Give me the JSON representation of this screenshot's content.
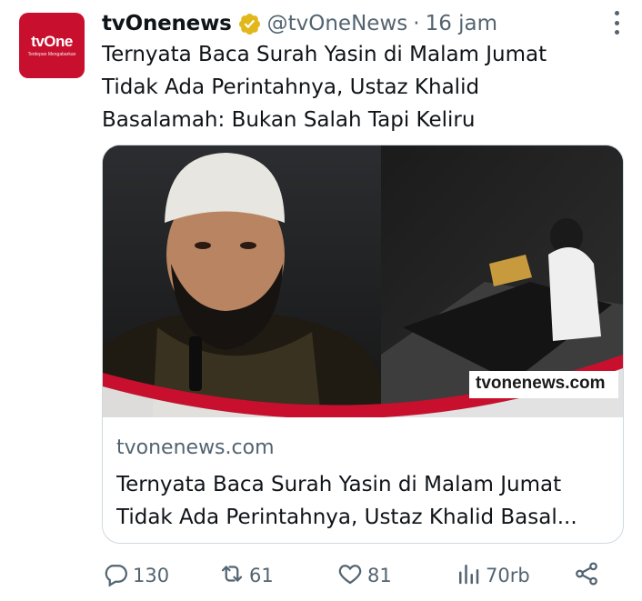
{
  "account": {
    "avatar_logo": "tvOne",
    "avatar_sub": "Terdepan Mengabarkan",
    "name": "tvOnenews",
    "handle": "@tvOneNews",
    "separator": "·",
    "time": "16 jam"
  },
  "tweet": {
    "text_lines": [
      "Ternyata Baca Surah Yasin di Malam Jumat",
      "Tidak Ada Perintahnya, Ustaz Khalid",
      "Basalamah: Bukan Salah Tapi Keliru"
    ]
  },
  "card": {
    "watermark": "tvonenews.com",
    "domain": "tvonenews.com",
    "title_lines": [
      "Ternyata Baca Surah Yasin di Malam Jumat",
      "Tidak Ada Perintahnya, Ustaz Khalid Basal..."
    ]
  },
  "actions": {
    "replies": "130",
    "reposts": "61",
    "likes": "81",
    "views": "70rb"
  },
  "colors": {
    "brand_red": "#c8102e",
    "verified_gold": "#e2b719",
    "muted_text": "#536471"
  },
  "icons": [
    "verified-badge-icon",
    "more-icon",
    "reply-icon",
    "repost-icon",
    "like-icon",
    "views-icon",
    "share-icon"
  ]
}
